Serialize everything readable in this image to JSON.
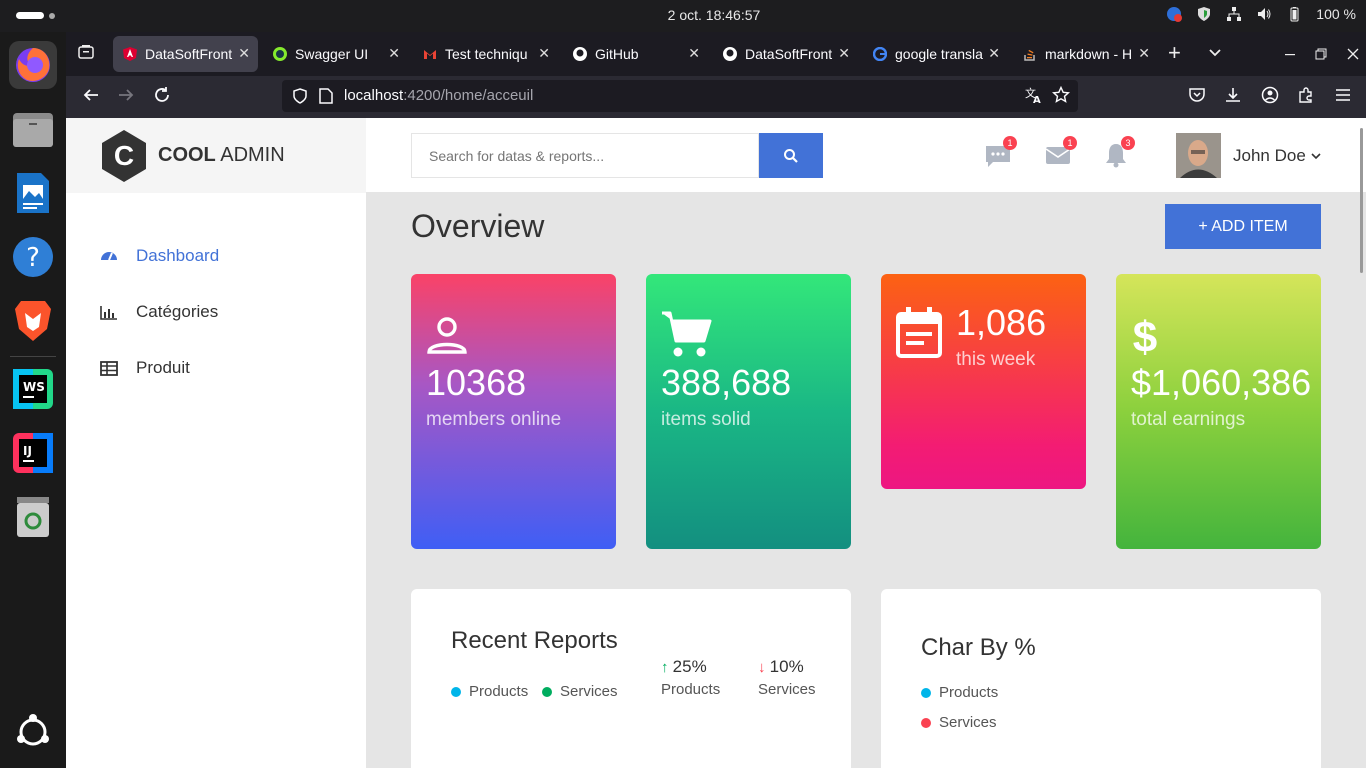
{
  "system": {
    "clock": "2 oct.   18:46:57",
    "battery": "100 %"
  },
  "browser": {
    "tabs": [
      {
        "title": "DataSoftFront",
        "active": true,
        "favicon_color": "#dd0031"
      },
      {
        "title": "Swagger UI",
        "active": false,
        "favicon_color": "#85ea2d"
      },
      {
        "title": "Test techniqu",
        "active": false,
        "favicon_color": "#ea4335"
      },
      {
        "title": "GitHub",
        "active": false,
        "favicon_color": "#ffffff"
      },
      {
        "title": "DataSoftFront",
        "active": false,
        "favicon_color": "#ffffff"
      },
      {
        "title": "google transla",
        "active": false,
        "favicon_color": "#4285f4"
      },
      {
        "title": "markdown - H",
        "active": false,
        "favicon_color": "#f48024"
      }
    ],
    "url_host": "localhost",
    "url_path": ":4200/home/acceuil"
  },
  "app": {
    "logo_bold": "COOL",
    "logo_light": "ADMIN",
    "menu": [
      {
        "label": "Dashboard",
        "active": true,
        "icon": "tachometer-icon"
      },
      {
        "label": "Catégories",
        "active": false,
        "icon": "bar-chart-icon"
      },
      {
        "label": "Produit",
        "active": false,
        "icon": "table-icon"
      }
    ],
    "search_placeholder": "Search for datas & reports...",
    "notifications": {
      "messages": "1",
      "mail": "1",
      "alerts": "3"
    },
    "user_name": "John Doe",
    "page_title": "Overview",
    "add_button": "+ ADD ITEM",
    "stats": [
      {
        "value": "10368",
        "label": "members online",
        "icon": "account-icon"
      },
      {
        "value": "388,688",
        "label": "items solid",
        "icon": "shopping-cart-icon"
      },
      {
        "value": "1,086",
        "label": "this week",
        "icon": "calendar-note-icon"
      },
      {
        "value": "$1,060,386",
        "label": "total earnings",
        "icon": "money-icon"
      }
    ],
    "recent_reports": {
      "title": "Recent Reports",
      "legend": [
        "Products",
        "Services"
      ],
      "stat1_pct": "25%",
      "stat1_label": "Products",
      "stat2_pct": "10%",
      "stat2_label": "Services"
    },
    "char_by": {
      "title": "Char By %",
      "legend": [
        "Products",
        "Services"
      ]
    }
  },
  "colors": {
    "accent": "#4272d7",
    "products": "#00b5e9",
    "services_reports": "#00ad5f",
    "services_char": "#fa4251",
    "up": "#00ad5f",
    "down": "#fa4251"
  }
}
